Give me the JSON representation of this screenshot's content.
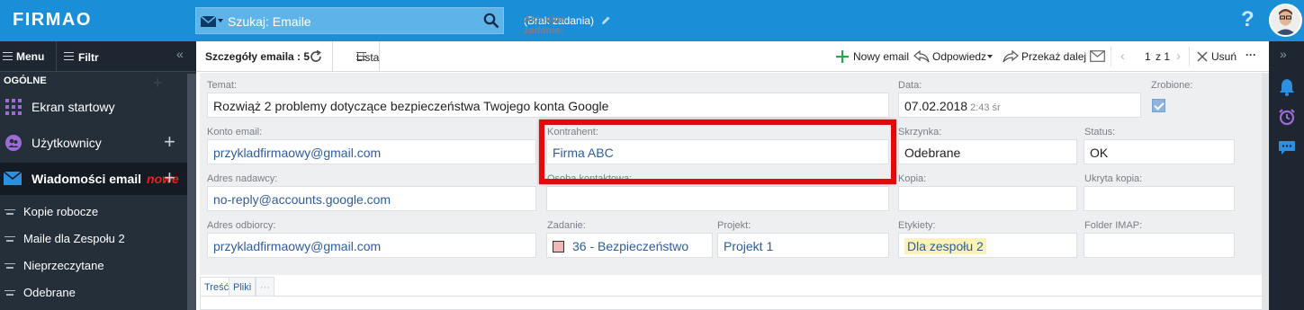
{
  "app": {
    "logo": "FIRMAO"
  },
  "topbar": {
    "search_placeholder": "Szukaj: Emaile",
    "task_label": "Aktualne zadanie:",
    "task_value": "(Brak zadania)",
    "help": "?"
  },
  "sidebar": {
    "menu_label": "Menu",
    "filter_label": "Filtr",
    "section": "OGÓLNE",
    "items": [
      {
        "label": "Ekran startowy"
      },
      {
        "label": "Użytkownicy"
      },
      {
        "label": "Wiadomości email",
        "badge": "nowe"
      }
    ],
    "subitems": [
      {
        "label": "Kopie robocze"
      },
      {
        "label": "Maile dla Zespołu 2"
      },
      {
        "label": "Nieprzeczytane"
      },
      {
        "label": "Odebrane"
      }
    ]
  },
  "toolbar": {
    "title": "Szczegóły emaila : 5",
    "list": "Lista",
    "new_email": "Nowy email",
    "reply": "Odpowiedz",
    "forward": "Przekaż dalej",
    "page_current": "1",
    "page_of": "z 1",
    "delete": "Usuń",
    "more": "···"
  },
  "form": {
    "subject_label": "Temat:",
    "subject": "Rozwiąż 2 problemy dotyczące bezpieczeństwa Twojego konta Google",
    "date_label": "Data:",
    "date": "07.02.2018",
    "time": "2:43 śr",
    "done_label": "Zrobione:",
    "account_label": "Konto email:",
    "account": "przykladfirmaowy@gmail.com",
    "contractor_label": "Kontrahent:",
    "contractor": "Firma ABC",
    "mailbox_label": "Skrzynka:",
    "mailbox": "Odebrane",
    "status_label": "Status:",
    "status": "OK",
    "sender_label": "Adres nadawcy:",
    "sender": "no-reply@accounts.google.com",
    "contact_label": "Osoba kontaktowa:",
    "cc_label": "Kopia:",
    "bcc_label": "Ukryta kopia:",
    "recipient_label": "Adres odbiorcy:",
    "recipient": "przykladfirmaowy@gmail.com",
    "task_label": "Zadanie:",
    "task": "36 - Bezpieczeństwo",
    "project_label": "Projekt:",
    "project": "Projekt 1",
    "tags_label": "Etykiety:",
    "tag": "Dla zespołu 2",
    "imap_label": "Folder IMAP:"
  },
  "tabs": [
    {
      "label": "Treść"
    },
    {
      "label": "Pliki"
    },
    {
      "label": "···"
    }
  ],
  "colors": {
    "topbar": "#1a8fd8",
    "sidebar": "#252f3a",
    "highlight": "#e10b0b",
    "link": "#2e5d9b"
  }
}
